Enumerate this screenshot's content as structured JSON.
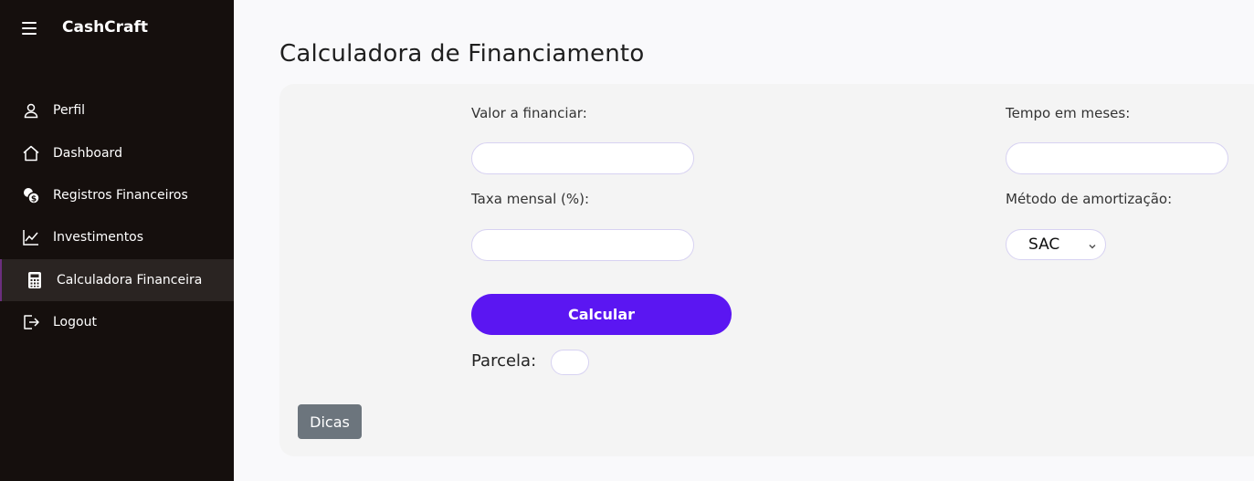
{
  "app": {
    "brand": "CashCraft"
  },
  "sidebar": {
    "items": [
      {
        "label": "Perfil",
        "icon": "user-icon"
      },
      {
        "label": "Dashboard",
        "icon": "home-icon"
      },
      {
        "label": "Registros Financeiros",
        "icon": "coins-icon"
      },
      {
        "label": "Investimentos",
        "icon": "chart-line-icon"
      },
      {
        "label": "Calculadora Financeira",
        "icon": "calculator-icon",
        "active": true
      },
      {
        "label": "Logout",
        "icon": "logout-icon"
      }
    ]
  },
  "main": {
    "title": "Calculadora de Financiamento",
    "form": {
      "valor_label": "Valor a financiar:",
      "valor_value": "",
      "tempo_label": "Tempo em meses:",
      "tempo_value": "",
      "taxa_label": "Taxa mensal (%):",
      "taxa_value": "",
      "metodo_label": "Método de amortização:",
      "metodo_value": "SAC",
      "calcular_label": "Calcular",
      "parcela_label": "Parcela:",
      "parcela_value": ""
    },
    "dicas_label": "Dicas"
  },
  "colors": {
    "sidebar_bg": "#150f0d",
    "accent": "#5b16f2",
    "active_border": "#6b2f7e",
    "dicas_bg": "#6c757d"
  }
}
